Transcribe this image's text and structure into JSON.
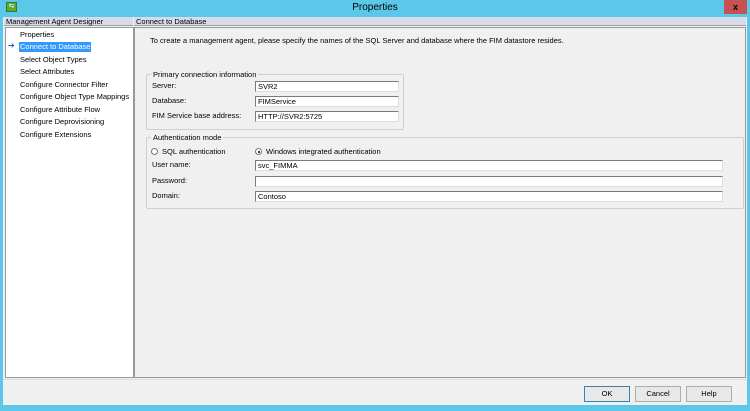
{
  "window": {
    "title": "Properties",
    "close_label": "x"
  },
  "sidebar": {
    "header": "Management Agent Designer",
    "items": [
      {
        "label": "Properties"
      },
      {
        "label": "Connect to Database",
        "selected": true
      },
      {
        "label": "Select Object Types"
      },
      {
        "label": "Select Attributes"
      },
      {
        "label": "Configure Connector Filter"
      },
      {
        "label": "Configure Object Type Mappings"
      },
      {
        "label": "Configure Attribute Flow"
      },
      {
        "label": "Configure Deprovisioning"
      },
      {
        "label": "Configure Extensions"
      }
    ],
    "selected_arrow": "➔"
  },
  "main": {
    "header": "Connect to Database",
    "intro": "To create a management agent, please specify the names of the SQL Server and database where the FIM datastore resides.",
    "primary": {
      "legend": "Primary connection information",
      "server_label": "Server:",
      "server_value": "SVR2",
      "database_label": "Database:",
      "database_value": "FIMService",
      "fim_label": "FIM Service base address:",
      "fim_value": "HTTP://SVR2:5725"
    },
    "auth": {
      "legend": "Authentication mode",
      "sql_label": "SQL authentication",
      "windows_label": "Windows integrated authentication",
      "selected": "windows",
      "user_label": "User name:",
      "user_value": "svc_FIMMA",
      "password_label": "Password:",
      "password_value": "",
      "domain_label": "Domain:",
      "domain_value": "Contoso"
    }
  },
  "buttons": {
    "ok": "OK",
    "cancel": "Cancel",
    "help": "Help"
  }
}
